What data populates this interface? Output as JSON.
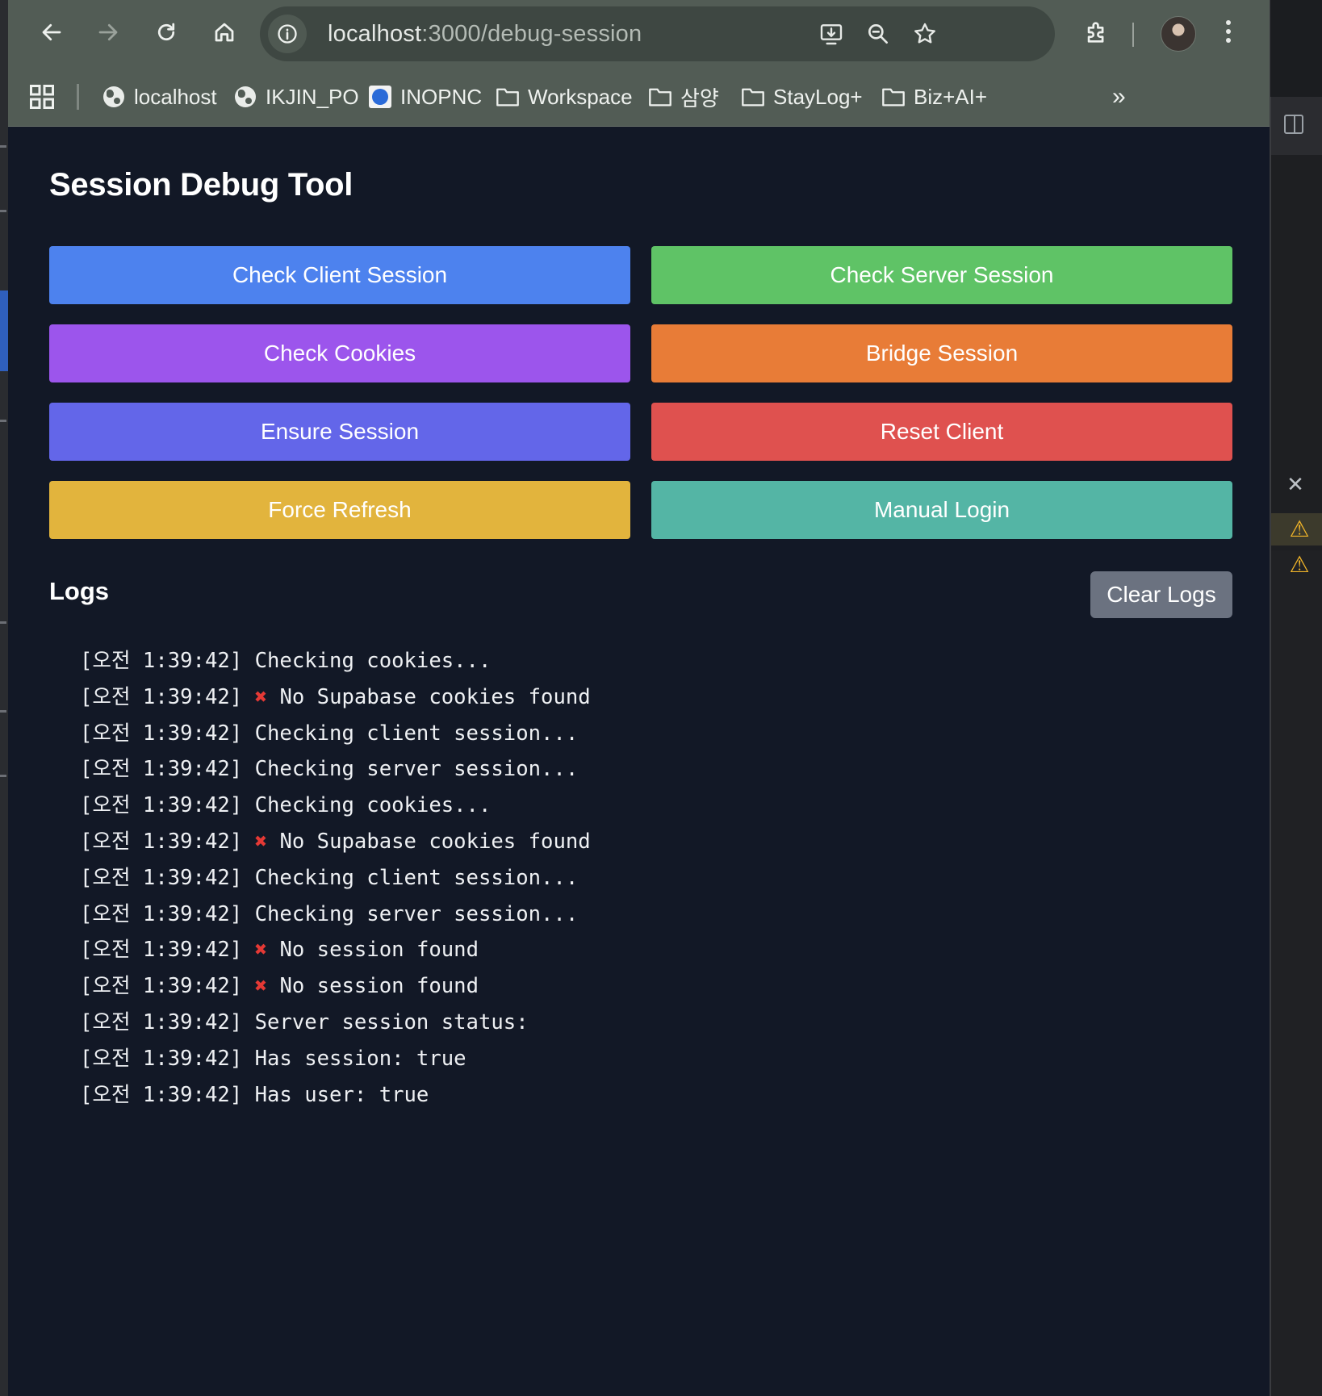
{
  "browser": {
    "url_host": "localhost",
    "url_path": ":3000/debug-session",
    "bookmarks": [
      {
        "label": "localhost",
        "icon": "globe-icon"
      },
      {
        "label": "IKJIN_PO",
        "icon": "globe-icon"
      },
      {
        "label": "INOPNC",
        "icon": "inopnc-favicon"
      },
      {
        "label": "Workspace",
        "icon": "folder-icon"
      },
      {
        "label": "삼양",
        "icon": "folder-icon"
      },
      {
        "label": "StayLog+",
        "icon": "folder-icon"
      },
      {
        "label": "Biz+AI+",
        "icon": "folder-icon"
      }
    ]
  },
  "page": {
    "title": "Session Debug Tool",
    "buttons": [
      {
        "label": "Check Client Session",
        "color": "#4d82ee"
      },
      {
        "label": "Check Server Session",
        "color": "#5fc366"
      },
      {
        "label": "Check Cookies",
        "color": "#9c55ec"
      },
      {
        "label": "Bridge Session",
        "color": "#e87c37"
      },
      {
        "label": "Ensure Session",
        "color": "#6366e9"
      },
      {
        "label": "Reset Client",
        "color": "#df514f"
      },
      {
        "label": "Force Refresh",
        "color": "#e2b43d"
      },
      {
        "label": "Manual Login",
        "color": "#54b5a5"
      }
    ],
    "logs_heading": "Logs",
    "clear_logs_label": "Clear Logs",
    "logs": [
      {
        "time": "[오전 1:39:42]",
        "error": false,
        "message": "Checking cookies..."
      },
      {
        "time": "[오전 1:39:42]",
        "error": true,
        "message": "No Supabase cookies found"
      },
      {
        "time": "[오전 1:39:42]",
        "error": false,
        "message": "Checking client session..."
      },
      {
        "time": "[오전 1:39:42]",
        "error": false,
        "message": "Checking server session..."
      },
      {
        "time": "[오전 1:39:42]",
        "error": false,
        "message": "Checking cookies..."
      },
      {
        "time": "[오전 1:39:42]",
        "error": true,
        "message": "No Supabase cookies found"
      },
      {
        "time": "[오전 1:39:42]",
        "error": false,
        "message": "Checking client session..."
      },
      {
        "time": "[오전 1:39:42]",
        "error": false,
        "message": "Checking server session..."
      },
      {
        "time": "[오전 1:39:42]",
        "error": true,
        "message": "No session found"
      },
      {
        "time": "[오전 1:39:42]",
        "error": true,
        "message": "No session found"
      },
      {
        "time": "[오전 1:39:42]",
        "error": false,
        "message": "Server session status:"
      },
      {
        "time": "[오전 1:39:42]",
        "error": false,
        "message": "Has session: true"
      },
      {
        "time": "[오전 1:39:42]",
        "error": false,
        "message": "Has user: true"
      }
    ]
  },
  "colors": {
    "page_bg": "#121826",
    "chrome_bg": "#525c55",
    "error_mark": "#e53935",
    "clear_button": "#6b7280"
  }
}
